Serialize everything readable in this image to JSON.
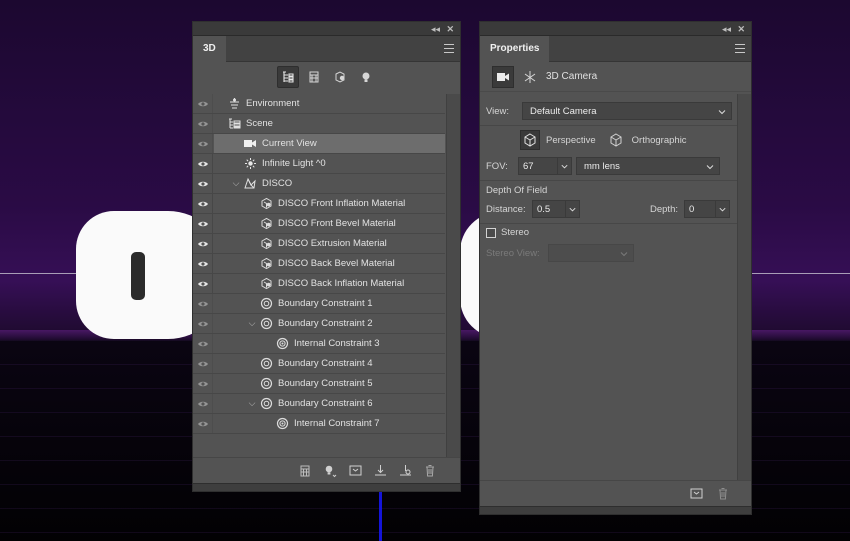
{
  "panel3d": {
    "tab": "3D",
    "layers": [
      {
        "label": "Environment",
        "icon": "environment-icon",
        "eye": "dim",
        "indent": 0,
        "twirl": ""
      },
      {
        "label": "Scene",
        "icon": "scene-icon",
        "eye": "dim",
        "indent": 0,
        "twirl": ""
      },
      {
        "label": "Current View",
        "icon": "camera-icon",
        "eye": "dim",
        "indent": 1,
        "twirl": "",
        "selected": true
      },
      {
        "label": "Infinite Light ^0",
        "icon": "light-icon",
        "eye": "on",
        "indent": 1,
        "twirl": ""
      },
      {
        "label": "DISCO",
        "icon": "mesh-icon",
        "eye": "on",
        "indent": 1,
        "twirl": "v"
      },
      {
        "label": "DISCO Front Inflation Material",
        "icon": "material-icon",
        "eye": "on",
        "indent": 2,
        "twirl": ""
      },
      {
        "label": "DISCO Front Bevel Material",
        "icon": "material-icon",
        "eye": "on",
        "indent": 2,
        "twirl": ""
      },
      {
        "label": "DISCO Extrusion Material",
        "icon": "material-icon",
        "eye": "on",
        "indent": 2,
        "twirl": ""
      },
      {
        "label": "DISCO Back Bevel Material",
        "icon": "material-icon",
        "eye": "on",
        "indent": 2,
        "twirl": ""
      },
      {
        "label": "DISCO Back Inflation Material",
        "icon": "material-icon",
        "eye": "on",
        "indent": 2,
        "twirl": ""
      },
      {
        "label": "Boundary Constraint 1",
        "icon": "constraint-icon",
        "eye": "dim",
        "indent": 2,
        "twirl": ""
      },
      {
        "label": "Boundary Constraint 2",
        "icon": "constraint-icon",
        "eye": "dim",
        "indent": 2,
        "twirl": "v"
      },
      {
        "label": "Internal Constraint 3",
        "icon": "internal-constraint-icon",
        "eye": "dim",
        "indent": 3,
        "twirl": ""
      },
      {
        "label": "Boundary Constraint 4",
        "icon": "constraint-icon",
        "eye": "dim",
        "indent": 2,
        "twirl": ""
      },
      {
        "label": "Boundary Constraint 5",
        "icon": "constraint-icon",
        "eye": "dim",
        "indent": 2,
        "twirl": ""
      },
      {
        "label": "Boundary Constraint 6",
        "icon": "constraint-icon",
        "eye": "dim",
        "indent": 2,
        "twirl": "v"
      },
      {
        "label": "Internal Constraint 7",
        "icon": "internal-constraint-icon",
        "eye": "dim",
        "indent": 3,
        "twirl": ""
      }
    ]
  },
  "properties": {
    "tab": "Properties",
    "header_title": "3D Camera",
    "view_label": "View:",
    "view_value": "Default Camera",
    "perspective_label": "Perspective",
    "orthographic_label": "Orthographic",
    "fov_label": "FOV:",
    "fov_value": "67",
    "fov_unit": "mm lens",
    "dof_label": "Depth Of Field",
    "distance_label": "Distance:",
    "distance_value": "0.5",
    "depth_label": "Depth:",
    "depth_value": "0",
    "stereo_label": "Stereo",
    "stereo_view_label": "Stereo View:"
  },
  "colors": {
    "panel_bg": "#535353",
    "selected_row": "#6d6d6d",
    "viewport_purple": "#2a0b45"
  }
}
